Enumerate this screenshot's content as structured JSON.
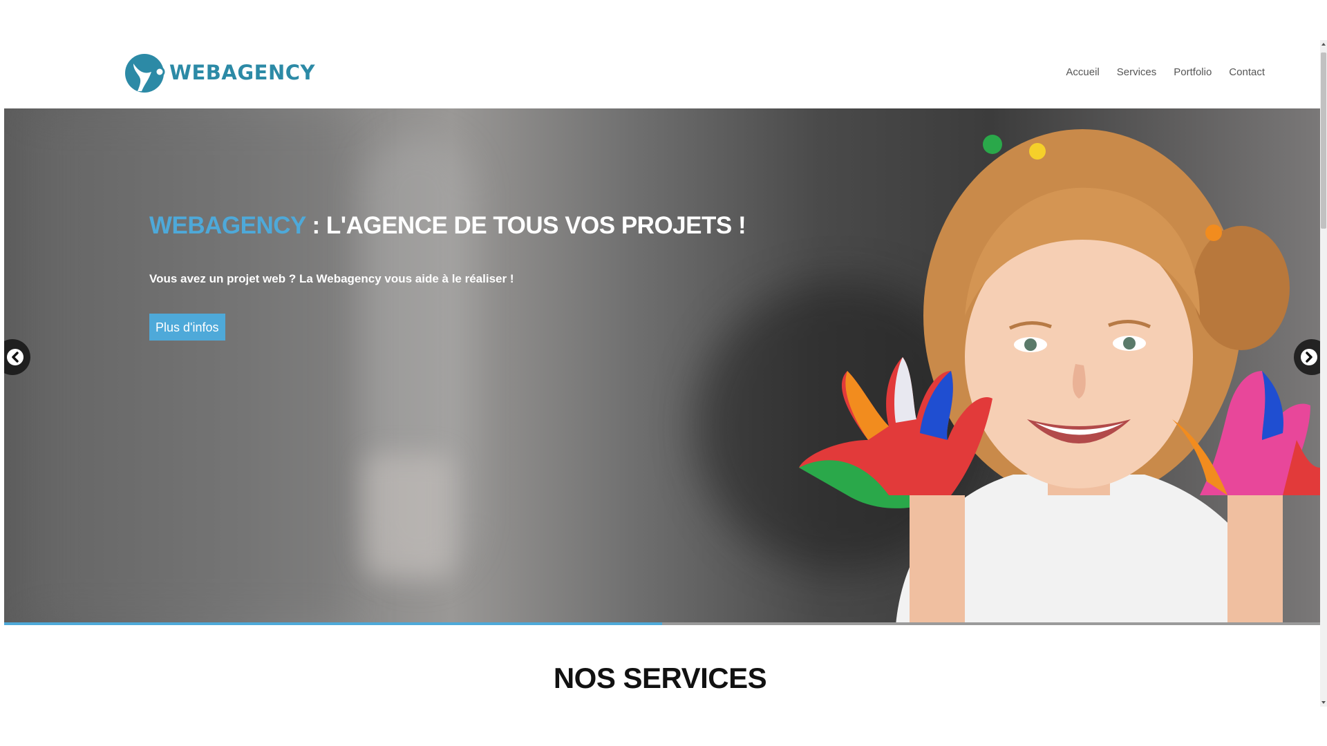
{
  "header": {
    "logo_text": "WEBAGENCY",
    "nav": [
      {
        "label": "Accueil"
      },
      {
        "label": "Services"
      },
      {
        "label": "Portfolio"
      },
      {
        "label": "Contact"
      }
    ]
  },
  "hero": {
    "title_brand": "WEBAGENCY",
    "title_rest": " : L'AGENCE DE TOUS VOS PROJETS !",
    "subtitle": "Vous avez un projet web ? La Webagency vous aide à le réaliser !",
    "button_label": "Plus d'infos",
    "progress_percent": 50
  },
  "section": {
    "title": "NOS SERVICES"
  },
  "colors": {
    "accent": "#4ea9d9",
    "logo": "#2c8aa6",
    "heading": "#111111"
  },
  "icons": {
    "prev": "chevron-left-icon",
    "next": "chevron-right-icon"
  }
}
